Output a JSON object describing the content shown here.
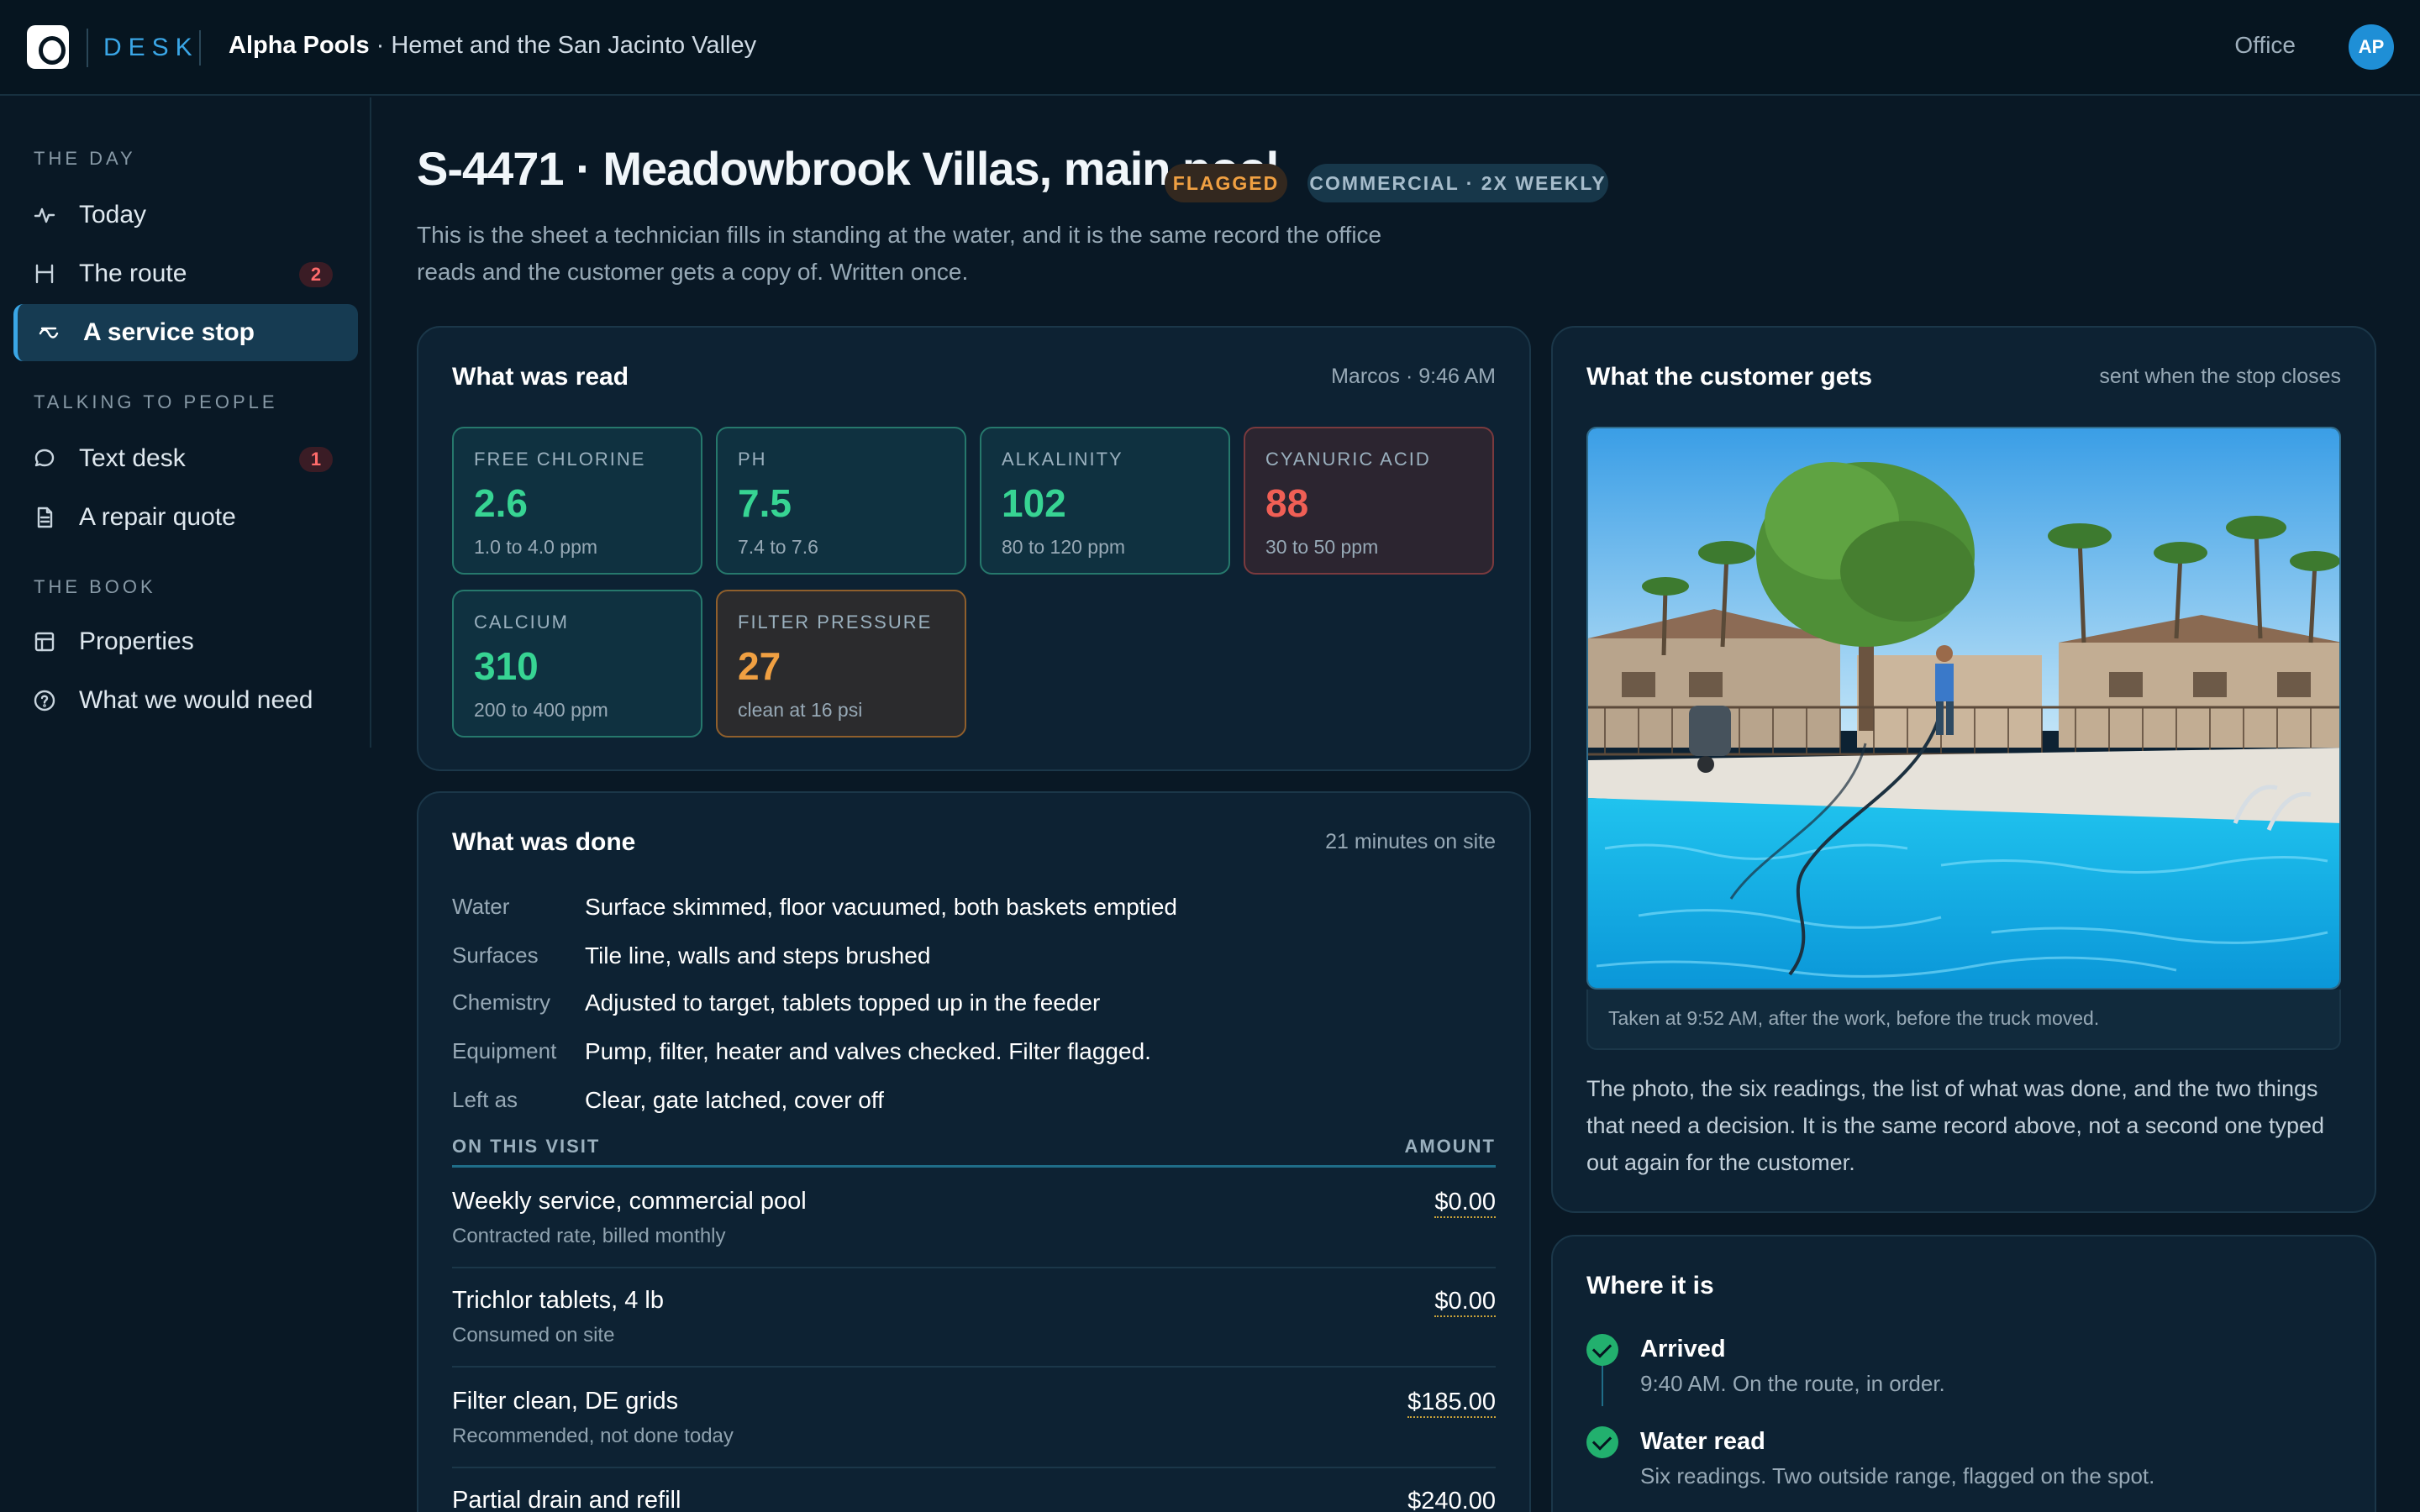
{
  "header": {
    "brand": "DESK",
    "company": "Alpha Pools",
    "region": " · Hemet and the San Jacinto Valley",
    "office_label": "Office",
    "avatar_initials": "AP"
  },
  "sidebar": {
    "sections": [
      {
        "label": "THE DAY"
      },
      {
        "label": "TALKING TO PEOPLE"
      },
      {
        "label": "THE BOOK"
      }
    ],
    "items": [
      {
        "label": "Today",
        "icon": "pulse-icon"
      },
      {
        "label": "The route",
        "icon": "route-icon",
        "badge": "2"
      },
      {
        "label": "A service stop",
        "icon": "stop-icon",
        "active": true
      },
      {
        "label": "Text desk",
        "icon": "chat-bubble-icon",
        "badge": "1"
      },
      {
        "label": "A repair quote",
        "icon": "document-icon"
      },
      {
        "label": "Properties",
        "icon": "layout-icon"
      },
      {
        "label": "What we would need",
        "icon": "help-circle-icon"
      }
    ]
  },
  "stop": {
    "title": "S-4471 · Meadowbrook Villas, main pool",
    "status_pill": "FLAGGED",
    "type_pill": "COMMERCIAL · 2X WEEKLY",
    "description": "This is the sheet a technician fills in standing at the water, and it is the same record the office reads and the customer gets a copy of. Written once."
  },
  "readings": {
    "title": "What was read",
    "meta": "Marcos · 9:46 AM",
    "tiles": [
      {
        "label": "FREE CHLORINE",
        "value": "2.6",
        "range": "1.0 to 4.0 ppm",
        "state": "ok"
      },
      {
        "label": "PH",
        "value": "7.5",
        "range": "7.4 to 7.6",
        "state": "ok"
      },
      {
        "label": "ALKALINITY",
        "value": "102",
        "range": "80 to 120 ppm",
        "state": "ok"
      },
      {
        "label": "CYANURIC ACID",
        "value": "88",
        "range": "30 to 50 ppm",
        "state": "bad"
      },
      {
        "label": "CALCIUM",
        "value": "310",
        "range": "200 to 400 ppm",
        "state": "ok"
      },
      {
        "label": "FILTER PRESSURE",
        "value": "27",
        "range": "clean at 16 psi",
        "state": "warn"
      }
    ]
  },
  "work": {
    "title": "What was done",
    "meta": "21 minutes on site",
    "rows": [
      {
        "key": "Water",
        "value": "Surface skimmed, floor vacuumed, both baskets emptied"
      },
      {
        "key": "Surfaces",
        "value": "Tile line, walls and steps brushed"
      },
      {
        "key": "Chemistry",
        "value": "Adjusted to target, tablets topped up in the feeder"
      },
      {
        "key": "Equipment",
        "value": "Pump, filter, heater and valves checked. Filter flagged."
      },
      {
        "key": "Left as",
        "value": "Clear, gate latched, cover off"
      }
    ],
    "table_header": {
      "left": "ON THIS VISIT",
      "right": "AMOUNT"
    },
    "line_items": [
      {
        "name": "Weekly service, commercial pool",
        "sub": "Contracted rate, billed monthly",
        "amount": "$0.00"
      },
      {
        "name": "Trichlor tablets, 4 lb",
        "sub": "Consumed on site",
        "amount": "$0.00"
      },
      {
        "name": "Filter clean, DE grids",
        "sub": "Recommended, not done today",
        "amount": "$185.00"
      },
      {
        "name": "Partial drain and refill",
        "sub": "",
        "amount": "$240.00"
      }
    ]
  },
  "customer": {
    "title": "What the customer gets",
    "meta": "sent when the stop closes",
    "photo_caption": "Taken at 9:52 AM, after the work, before the truck moved.",
    "text": "The photo, the six readings, the list of what was done, and the two things that need a decision. It is the same record above, not a second one typed out again for the customer."
  },
  "timeline": {
    "title": "Where it is",
    "steps": [
      {
        "name": "Arrived",
        "detail": "9:40 AM. On the route, in order."
      },
      {
        "name": "Water read",
        "detail": "Six readings. Two outside range, flagged on the spot."
      }
    ]
  },
  "colors": {
    "background": "#091825",
    "card": "#0d2233",
    "accent": "#3aa6e6",
    "ok": "#37d493",
    "bad": "#f05f55",
    "warn": "#f0a042"
  }
}
